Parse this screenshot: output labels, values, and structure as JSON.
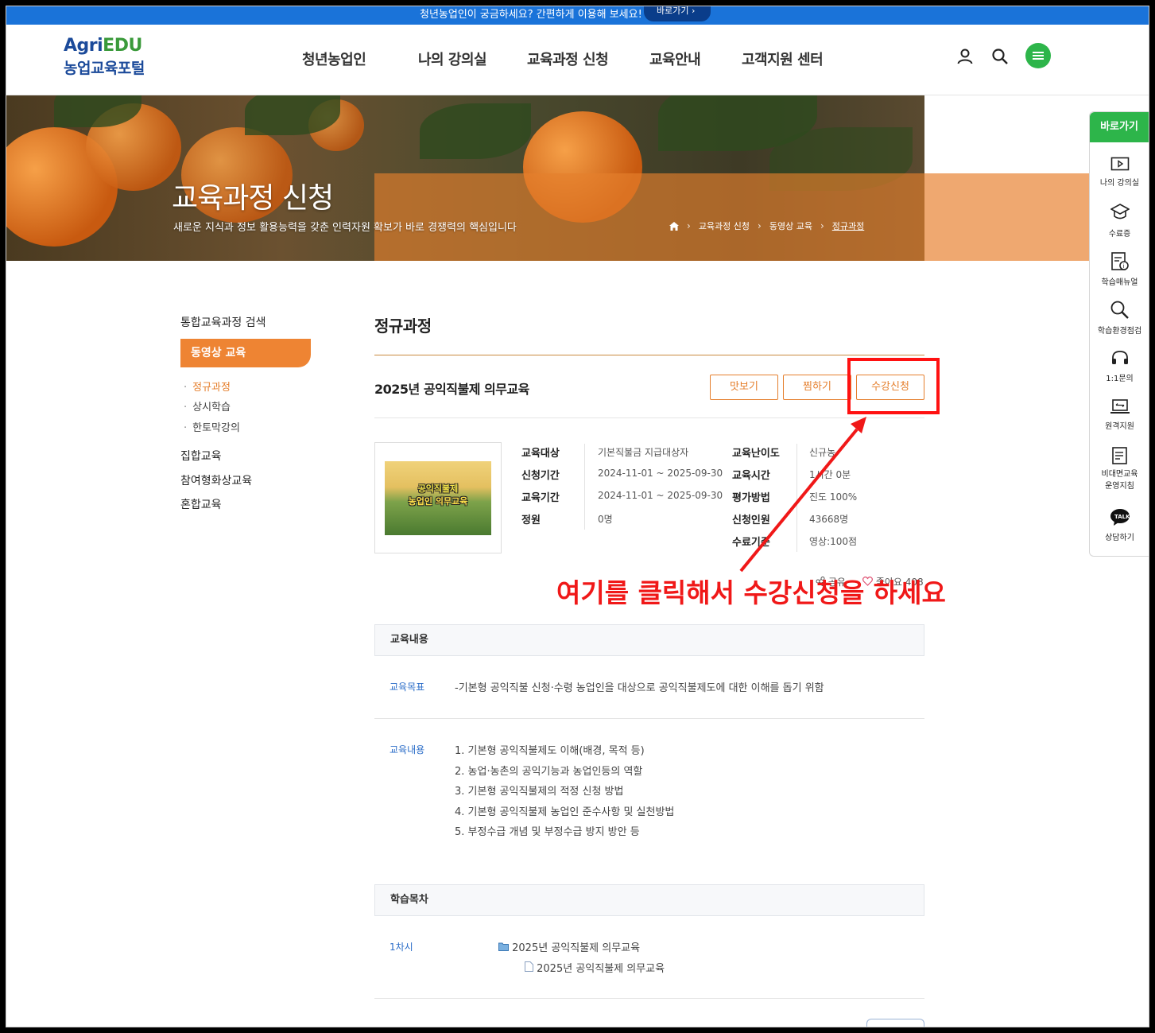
{
  "notice": {
    "text": "청년농업인이 궁금하세요? 간편하게 이용해 보세요!",
    "button": "바로가기"
  },
  "logo": {
    "brand": "Agri",
    "brand2": "EDU",
    "name": "농업교육포털"
  },
  "gnb": [
    "청년농업인",
    "나의 강의실",
    "교육과정 신청",
    "교육안내",
    "고객지원 센터"
  ],
  "header_icons": [
    "user-icon",
    "search-icon",
    "menu-icon"
  ],
  "hero": {
    "title": "교육과정 신청",
    "subtitle": "새로운 지식과 정보 활용능력을 갖춘 인력자원 확보가 바로 경쟁력의 핵심입니다",
    "breadcrumb": [
      "교육과정 신청",
      "동영상 교육",
      "정규과정"
    ]
  },
  "quick": {
    "title": "바로가기",
    "items": [
      "나의 강의실",
      "수료증",
      "학습매뉴얼",
      "학습환경점검",
      "1:1문의",
      "원격지원",
      "비대면교육",
      "운영지침",
      "상담하기"
    ]
  },
  "lnav": {
    "search": "통합교육과정 검색",
    "active": "동영상 교육",
    "subs": [
      "정규과정",
      "상시학습",
      "한토막강의"
    ],
    "others": [
      "집합교육",
      "참여형화상교육",
      "혼합교육"
    ]
  },
  "page": {
    "title": "정규과정",
    "course_title": "2025년 공익직불제 의무교육",
    "buttons": {
      "preview": "맛보기",
      "wish": "찜하기",
      "apply": "수강신청"
    },
    "thumb": {
      "line1": "공익직불제",
      "line2": "농업인 의무교육"
    },
    "info_left": [
      {
        "k": "교육대상",
        "v": "기본직불금 지급대상자"
      },
      {
        "k": "신청기간",
        "v": "2024-11-01 ~ 2025-09-30"
      },
      {
        "k": "교육기간",
        "v": "2024-11-01 ~ 2025-09-30"
      },
      {
        "k": "정원",
        "v": "0명"
      }
    ],
    "info_right": [
      {
        "k": "교육난이도",
        "v": "신규농"
      },
      {
        "k": "교육시간",
        "v": "1시간 0분"
      },
      {
        "k": "평가방법",
        "v": "진도 100%"
      },
      {
        "k": "신청인원",
        "v": "43668명"
      },
      {
        "k": "수료기준",
        "v": "영상:100점"
      }
    ],
    "share": "공유",
    "likes": "좋아요 408",
    "section1": "교육내용",
    "goal_label": "교육목표",
    "goal_text": "-기본형 공익직불 신청·수령 농업인을 대상으로 공익직불제도에 대한 이해를 돕기 위함",
    "content_label": "교육내용",
    "content_items": [
      "1. 기본형 공익직불제도 이해(배경, 목적 등)",
      "2. 농업·농촌의 공익기능과 농업인등의 역할",
      "3. 기본형 공익직불제의 적정 신청 방법",
      "4. 기본형 공익직불제 농업인 준수사항 및 실천방법",
      "5. 부정수급 개념 및 부정수급 방지 방안 등"
    ],
    "section2": "학습목차",
    "toc_label": "1차시",
    "toc_main": "2025년 공익직불제 의무교육",
    "toc_sub": "2025년 공익직불제 의무교육"
  },
  "annotation": {
    "text": "여기를 클릭해서 수강신청을 하세요"
  },
  "colors": {
    "accent": "#e57f2d",
    "green": "#2db54a",
    "blue": "#1a73d9",
    "red": "#f01818"
  }
}
